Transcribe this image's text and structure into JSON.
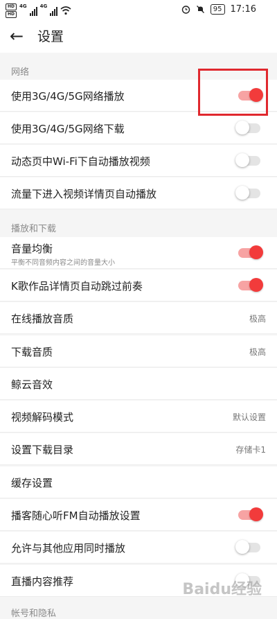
{
  "status_bar": {
    "left_indicators": [
      "HD",
      "HD"
    ],
    "network_labels": [
      "4G",
      "4G"
    ],
    "battery": "95",
    "time": "17:16",
    "icons": [
      "alarm-icon",
      "mute-icon",
      "wifi-icon",
      "signal-icon"
    ]
  },
  "header": {
    "back_icon": "←",
    "title": "设置"
  },
  "sections": {
    "network": "网络",
    "playback": "播放和下载",
    "account": "帐号和隐私"
  },
  "rows": {
    "net_play": {
      "label": "使用3G/4G/5G网络播放",
      "on": true
    },
    "net_download": {
      "label": "使用3G/4G/5G网络下载",
      "on": false
    },
    "feed_autoplay": {
      "label": "动态页中Wi-Fi下自动播放视频",
      "on": false
    },
    "data_autoplay": {
      "label": "流量下进入视频详情页自动播放",
      "on": false
    },
    "volume_balance": {
      "label": "音量均衡",
      "sublabel": "平衡不同音频内容之间的音量大小",
      "on": true
    },
    "k_skip_intro": {
      "label": "K歌作品详情页自动跳过前奏",
      "on": true
    },
    "online_quality": {
      "label": "在线播放音质",
      "value": "极高"
    },
    "download_quality": {
      "label": "下载音质",
      "value": "极高"
    },
    "whale_sound": {
      "label": "鲸云音效"
    },
    "video_decode": {
      "label": "视频解码模式",
      "value": "默认设置"
    },
    "download_dir": {
      "label": "设置下载目录",
      "value": "存储卡1"
    },
    "cache_settings": {
      "label": "缓存设置"
    },
    "fm_autoplay": {
      "label": "播客随心听FM自动播放设置",
      "on": true
    },
    "mix_play": {
      "label": "允许与其他应用同时播放",
      "on": false
    },
    "live_recommend": {
      "label": "直播内容推荐",
      "on": false
    }
  },
  "watermark": "Baidu经验"
}
